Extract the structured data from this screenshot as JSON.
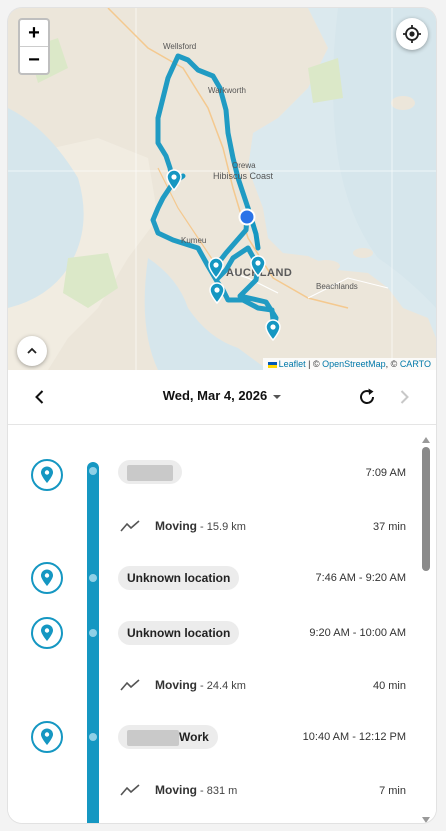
{
  "map": {
    "zoom_in_label": "+",
    "zoom_out_label": "−",
    "labels": {
      "wellsford": "Wellsford",
      "warkworth": "Warkworth",
      "orewa": "Orewa",
      "hibiscus_coast": "Hibiscus Coast",
      "kumeu": "Kumeu",
      "auckland": "AUCKLAND",
      "beachlands": "Beachlands"
    },
    "attribution": {
      "leaflet": "Leaflet",
      "sep1": " | © ",
      "osm": "OpenStreetMap",
      "sep2": ", © ",
      "carto": "CARTO"
    },
    "route_color": "#1597c2",
    "current_location_color": "#2a73e8",
    "icons": {
      "locate": "crosshair-icon",
      "collapse": "chevron-up-icon",
      "marker": "map-pin-icon"
    }
  },
  "datebar": {
    "date": "Wed, Mar 4, 2026",
    "icons": {
      "prev": "chevron-left-icon",
      "refresh": "refresh-icon",
      "next": "chevron-right-icon"
    }
  },
  "timeline": {
    "accent_color": "#1597c2",
    "stops": [
      {
        "name": "",
        "time": "7:09 AM"
      },
      {
        "name": "Unknown location",
        "time": "7:46 AM - 9:20 AM"
      },
      {
        "name": "Unknown location",
        "time": "9:20 AM - 10:00 AM"
      },
      {
        "name": "Work",
        "time": "10:40 AM - 12:12 PM"
      }
    ],
    "moves": [
      {
        "label": "Moving",
        "distance": " - 15.9 km",
        "duration": "37 min"
      },
      {
        "label": "Moving",
        "distance": " - 24.4 km",
        "duration": "40 min"
      },
      {
        "label": "Moving",
        "distance": " - 831 m",
        "duration": "7 min"
      }
    ]
  }
}
